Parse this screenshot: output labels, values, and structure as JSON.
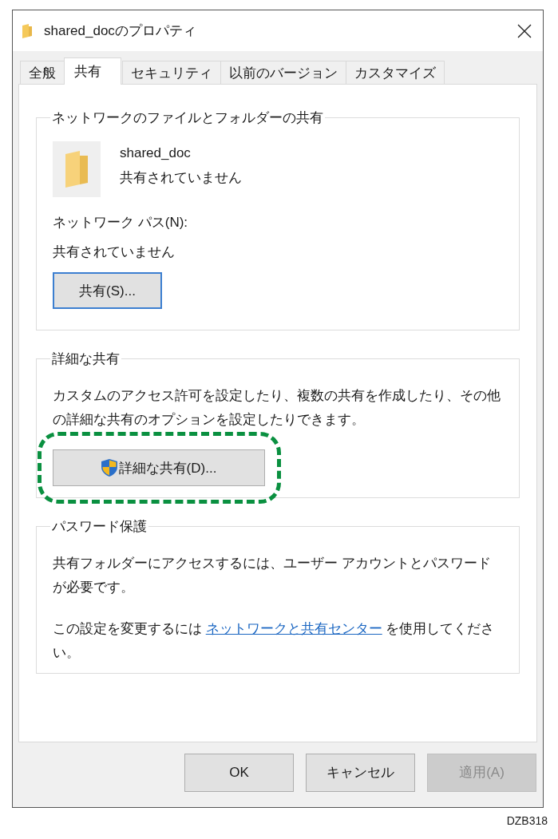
{
  "window": {
    "title": "shared_docのプロパティ"
  },
  "tabs": [
    {
      "label": "全般",
      "selected": false
    },
    {
      "label": "共有",
      "selected": true
    },
    {
      "label": "セキュリティ",
      "selected": false
    },
    {
      "label": "以前のバージョン",
      "selected": false
    },
    {
      "label": "カスタマイズ",
      "selected": false
    }
  ],
  "network_sharing": {
    "title": "ネットワークのファイルとフォルダーの共有",
    "item_name": "shared_doc",
    "item_status": "共有されていません",
    "path_label": "ネットワーク パス(N):",
    "path_value": "共有されていません",
    "button": {
      "label": "共有(S)...",
      "focused": true
    }
  },
  "advanced_sharing": {
    "title": "詳細な共有",
    "description": "カスタムのアクセス許可を設定したり、複数の共有を作成したり、その他の詳細な共有のオプションを設定したりできます。",
    "button": {
      "label": "詳細な共有(D)...",
      "highlighted": true
    }
  },
  "password_protection": {
    "title": "パスワード保護",
    "text": "共有フォルダーにアクセスするには、ユーザー アカウントとパスワードが必要です。",
    "hint_before": "この設定を変更するには",
    "link": "ネットワークと共有センター",
    "hint_after": "を使用してください。"
  },
  "buttons": [
    {
      "label": "OK",
      "disabled": false
    },
    {
      "label": "キャンセル",
      "disabled": false
    },
    {
      "label": "適用(A)",
      "disabled": true
    }
  ],
  "figure_code": "DZB318"
}
